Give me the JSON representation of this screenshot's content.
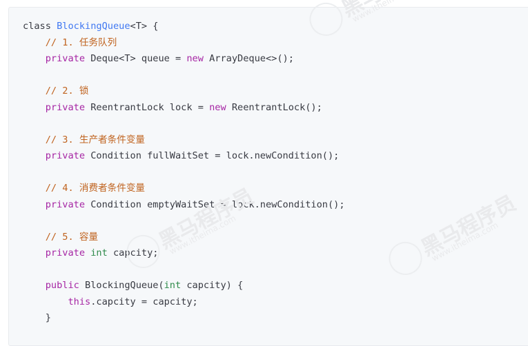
{
  "watermark": {
    "brand_cn": "黑马程序员",
    "site": "www.itheima.com"
  },
  "code": {
    "lines": [
      [
        {
          "t": "class ",
          "c": "plain"
        },
        {
          "t": "BlockingQueue",
          "c": "class"
        },
        {
          "t": "<T> {",
          "c": "plain"
        }
      ],
      [
        {
          "t": "    ",
          "c": "plain"
        },
        {
          "t": "// 1. 任务队列",
          "c": "comment"
        }
      ],
      [
        {
          "t": "    ",
          "c": "plain"
        },
        {
          "t": "private",
          "c": "keyword"
        },
        {
          "t": " Deque<T> queue = ",
          "c": "plain"
        },
        {
          "t": "new",
          "c": "keyword"
        },
        {
          "t": " ArrayDeque<>();",
          "c": "plain"
        }
      ],
      [],
      [
        {
          "t": "    ",
          "c": "plain"
        },
        {
          "t": "// 2. 锁",
          "c": "comment"
        }
      ],
      [
        {
          "t": "    ",
          "c": "plain"
        },
        {
          "t": "private",
          "c": "keyword"
        },
        {
          "t": " ReentrantLock lock = ",
          "c": "plain"
        },
        {
          "t": "new",
          "c": "keyword"
        },
        {
          "t": " ReentrantLock();",
          "c": "plain"
        }
      ],
      [],
      [
        {
          "t": "    ",
          "c": "plain"
        },
        {
          "t": "// 3. 生产者条件变量",
          "c": "comment"
        }
      ],
      [
        {
          "t": "    ",
          "c": "plain"
        },
        {
          "t": "private",
          "c": "keyword"
        },
        {
          "t": " Condition fullWaitSet = lock.newCondition();",
          "c": "plain"
        }
      ],
      [],
      [
        {
          "t": "    ",
          "c": "plain"
        },
        {
          "t": "// 4. 消费者条件变量",
          "c": "comment"
        }
      ],
      [
        {
          "t": "    ",
          "c": "plain"
        },
        {
          "t": "private",
          "c": "keyword"
        },
        {
          "t": " Condition emptyWaitSet = lock.newCondition();",
          "c": "plain"
        }
      ],
      [],
      [
        {
          "t": "    ",
          "c": "plain"
        },
        {
          "t": "// 5. 容量",
          "c": "comment"
        }
      ],
      [
        {
          "t": "    ",
          "c": "plain"
        },
        {
          "t": "private",
          "c": "keyword"
        },
        {
          "t": " ",
          "c": "plain"
        },
        {
          "t": "int",
          "c": "type"
        },
        {
          "t": " capcity;",
          "c": "plain"
        }
      ],
      [],
      [
        {
          "t": "    ",
          "c": "plain"
        },
        {
          "t": "public",
          "c": "keyword"
        },
        {
          "t": " BlockingQueue(",
          "c": "plain"
        },
        {
          "t": "int",
          "c": "type"
        },
        {
          "t": " capcity) {",
          "c": "plain"
        }
      ],
      [
        {
          "t": "        ",
          "c": "plain"
        },
        {
          "t": "this",
          "c": "keyword"
        },
        {
          "t": ".capcity = capcity;",
          "c": "plain"
        }
      ],
      [
        {
          "t": "    }",
          "c": "plain"
        }
      ]
    ]
  }
}
